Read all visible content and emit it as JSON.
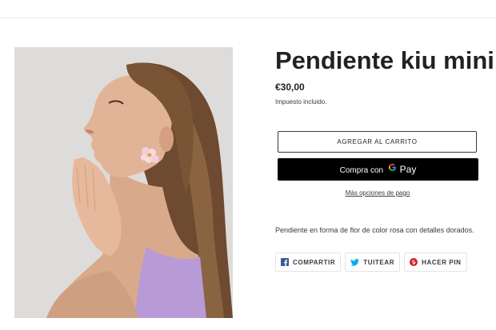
{
  "product": {
    "title": "Pendiente kiu mini",
    "price": "€30,00",
    "tax_note": "Impuesto incluido.",
    "description": "Pendiente en forma de flor de color rosa con detalles dorados."
  },
  "buttons": {
    "add_to_cart": "AGREGAR AL CARRITO",
    "gpay_prefix": "Compra con",
    "gpay_brand": "Pay",
    "more_payment_options": "Más opciones de pago"
  },
  "share": {
    "facebook": "COMPARTIR",
    "twitter": "TUITEAR",
    "pinterest": "HACER PIN"
  },
  "colors": {
    "facebook": "#3b5998",
    "twitter": "#00aced",
    "pinterest": "#cb2027",
    "tank_top": "#b89ad6"
  }
}
